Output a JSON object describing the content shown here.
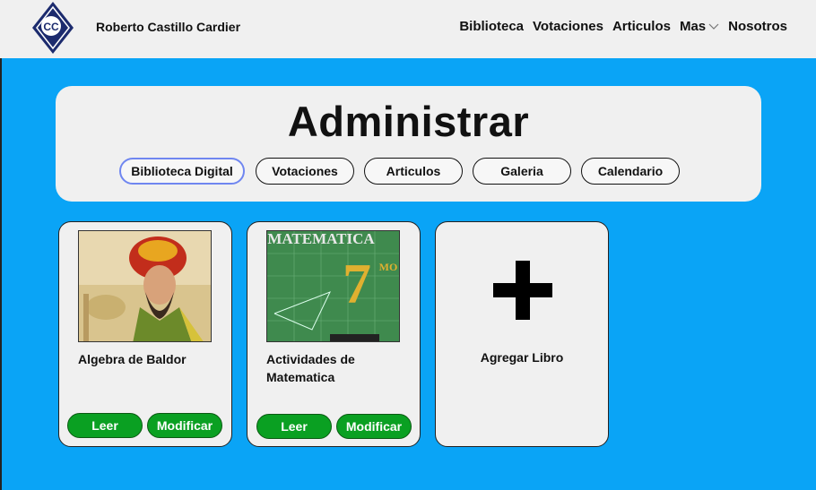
{
  "header": {
    "logo_text": "CC",
    "site_name": "Roberto Castillo Cardier",
    "nav": [
      "Biblioteca",
      "Votaciones",
      "Articulos",
      "Mas",
      "Nosotros"
    ]
  },
  "admin": {
    "title": "Administrar",
    "tabs": [
      "Biblioteca Digital",
      "Votaciones",
      "Articulos",
      "Galeria",
      "Calendario"
    ],
    "active_tab": "Biblioteca Digital"
  },
  "books": [
    {
      "title": "Algebra de Baldor",
      "read_label": "Leer",
      "edit_label": "Modificar",
      "cover_icon": "portrait-cover"
    },
    {
      "title": "Actividades de Matematica",
      "read_label": "Leer",
      "edit_label": "Modificar",
      "cover_icon": "math-cover",
      "cover_text": "MATEMATICA",
      "cover_number": "7",
      "cover_suffix": "MO"
    }
  ],
  "add_card": {
    "label": "Agregar Libro",
    "icon": "plus-icon"
  },
  "colors": {
    "background": "#0aa4f6",
    "panel": "#f0f0f0",
    "button": "#0aa022",
    "active_tab_border": "#6f86f0"
  }
}
